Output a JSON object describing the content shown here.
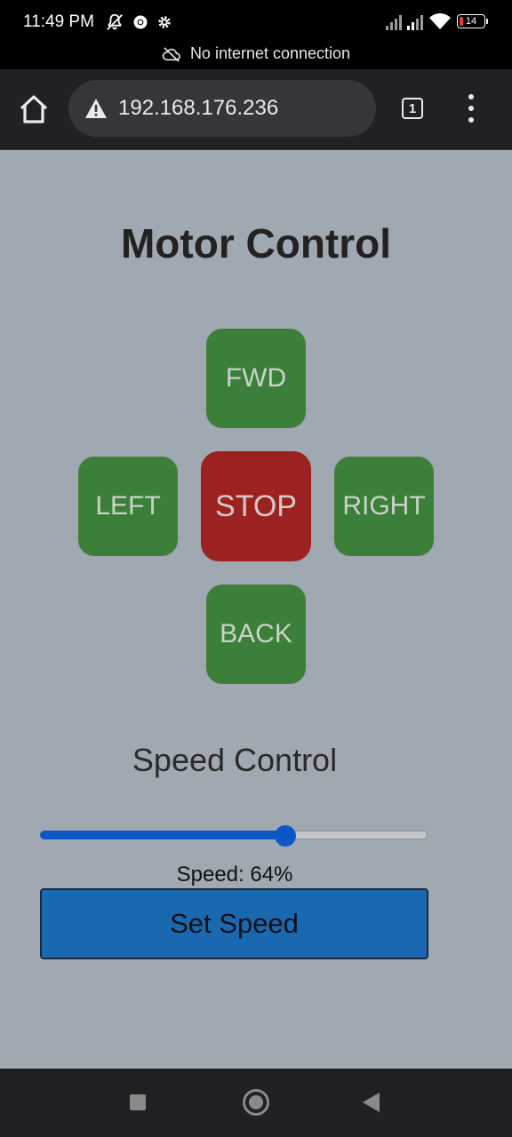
{
  "status_bar": {
    "time": "11:49 PM",
    "battery_level": "14",
    "notice": "No internet connection",
    "icons": [
      "bell-off-icon",
      "chrome-icon",
      "settings-icon",
      "signal-icon",
      "signal-icon",
      "wifi-icon",
      "battery-icon"
    ]
  },
  "browser": {
    "url": "192.168.176.236",
    "tab_count": "1",
    "icons": [
      "home-icon",
      "warning-icon",
      "tabs-icon",
      "menu-icon"
    ]
  },
  "page": {
    "title": "Motor Control",
    "controls": {
      "forward": "FWD",
      "left": "LEFT",
      "stop": "STOP",
      "right": "RIGHT",
      "back": "BACK"
    },
    "speed": {
      "heading": "Speed Control",
      "value_percent": 64,
      "readout": "Speed: 64%",
      "set_button": "Set Speed"
    }
  },
  "colors": {
    "page_background": "#a0a8b1",
    "direction_button": "#3c7f3a",
    "stop_button": "#9c2121",
    "slider_accent": "#0d57c5",
    "set_speed_button": "#1a69b0"
  },
  "nav_bar": {
    "icons": [
      "recents-icon",
      "home-circle-icon",
      "back-triangle-icon"
    ]
  }
}
